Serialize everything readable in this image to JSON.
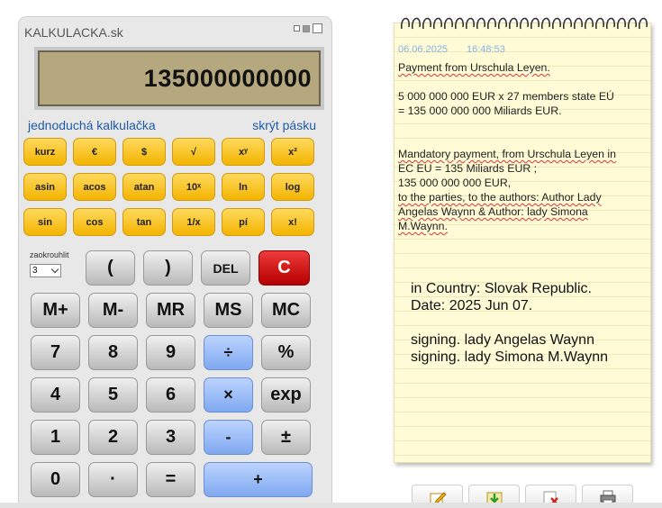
{
  "calculator": {
    "title": "KALKULACKA.sk",
    "display": "135000000000",
    "link_simple": "jednoduchá kalkulačka",
    "link_hide_tape": "skrýt pásku",
    "func_rows": [
      [
        "kurz",
        "€",
        "$",
        "√",
        "xʸ",
        "x²"
      ],
      [
        "asin",
        "acos",
        "atan",
        "10ˣ",
        "ln",
        "log"
      ],
      [
        "sin",
        "cos",
        "tan",
        "1/x",
        "pí",
        "x!"
      ]
    ],
    "round_label": "zaokrouhlit",
    "round_value": "3",
    "paren_open": "(",
    "paren_close": ")",
    "del": "DEL",
    "clear": "C",
    "memory": [
      "M+",
      "M-",
      "MR",
      "MS",
      "MC"
    ],
    "keys": {
      "k7": "7",
      "k8": "8",
      "k9": "9",
      "div": "÷",
      "pct": "%",
      "k4": "4",
      "k5": "5",
      "k6": "6",
      "mul": "×",
      "exp": "exp",
      "k1": "1",
      "k2": "2",
      "k3": "3",
      "sub": "-",
      "pm": "±",
      "k0": "0",
      "dot": "·",
      "eq": "=",
      "add": "+"
    }
  },
  "note": {
    "date": "06.06.2025",
    "time": "16:48:53",
    "lines": {
      "p1": "Payment from Urschula Leyen.",
      "p2a": "5 000 000 000 EUR x 27 members state EÚ",
      "p2b": "= 135 000 000 000 Miliards EUR.",
      "p3a": "Mandatory payment, from Urschula Leyen in",
      "p3b": "EC EU = 135 Miliards EUR ;",
      "p3c": "135 000 000 000 EUR,",
      "p3d": "to the parties, to the authors: Author Lady",
      "p3e": "Angelas Waynn & Author: lady Simona",
      "p3f": "M.Waynn."
    },
    "big": {
      "country": "in Country:  Slovak Republic.",
      "date": "Date: 2025 Jun 07.",
      "sign1": "signing.  lady Angelas Waynn",
      "sign2": "signing.  lady Simona M.Waynn"
    }
  },
  "toolbar": [
    "edit-note-icon",
    "save-note-icon",
    "delete-note-icon",
    "print-note-icon"
  ],
  "colors": {
    "yellow_key": "#f4b400",
    "blue_key": "#7fa8f0",
    "red_key": "#b40000",
    "lcd": "#b5a87e",
    "note_bg": "#fffbd6",
    "link": "#1f5aa6"
  }
}
